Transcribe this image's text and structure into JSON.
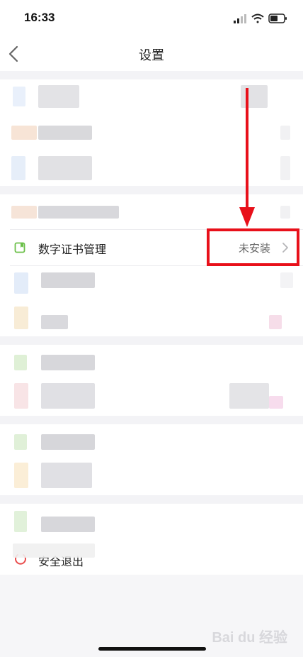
{
  "status_bar": {
    "time": "16:33"
  },
  "nav": {
    "title": "设置"
  },
  "cert_row": {
    "label": "数字证书管理",
    "status": "未安装"
  },
  "logout": {
    "label": "安全退出"
  },
  "watermark": {
    "text": "Bai du 经验"
  },
  "colors": {
    "highlight": "#e8101a",
    "background": "#f6f6f8",
    "cert_icon": "#6cc04a",
    "logout_icon": "#e94b4b"
  },
  "icons": {
    "back": "chevron-left-icon",
    "cert": "certificate-icon",
    "chevron": "chevron-right-icon",
    "logout": "power-icon"
  }
}
